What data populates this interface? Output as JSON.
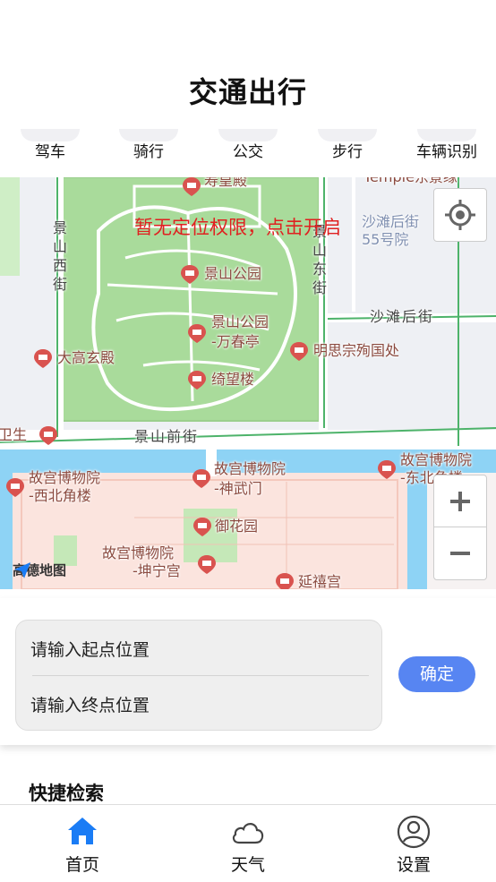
{
  "header": {
    "title": "交通出行"
  },
  "mode_tabs": [
    {
      "label": "驾车"
    },
    {
      "label": "骑行"
    },
    {
      "label": "公交"
    },
    {
      "label": "步行"
    },
    {
      "label": "车辆识别"
    }
  ],
  "map": {
    "permission_alert": "暂无定位权限，点击开启",
    "roads": {
      "jingshan_west": "景山西街",
      "jingshan_east": "景山东街",
      "jingshan_front": "景山前街",
      "shatan_back": "沙滩后街",
      "partial_left": "卫生"
    },
    "pois": {
      "shouhuangdian": "寿皇殿",
      "temple": "Temple东景缘",
      "shatan_55": "沙滩后街\n55号院",
      "jingshan_park": "景山公园",
      "wanchun_line1": "景山公园",
      "wanchun_line2": "-万春亭",
      "mingsizong": "明思宗殉国处",
      "dagaoxuan": "大高玄殿",
      "qiwanglou": "绮望楼",
      "gugong_xibei_1": "故宫博物院",
      "gugong_xibei_2": "-西北角楼",
      "gugong_shenwu_1": "故宫博物院",
      "gugong_shenwu_2": "-神武门",
      "gugong_dongbei_1": "故宫博物院",
      "gugong_dongbei_2": "-东北角楼",
      "yuhuayuan": "御花园",
      "gugong_kunning_1": "故宫博物院",
      "gugong_kunning_2": "-坤宁宫",
      "yanxigong": "延禧宫"
    },
    "logo_text": "高德地图",
    "zoom_in": "+",
    "zoom_out": "−"
  },
  "route": {
    "start_placeholder": "请输入起点位置",
    "end_placeholder": "请输入终点位置",
    "confirm_label": "确定"
  },
  "quick_search": {
    "title": "快捷检索"
  },
  "bottom_nav": [
    {
      "label": "首页",
      "icon": "home-icon",
      "active": true
    },
    {
      "label": "天气",
      "icon": "cloud-icon",
      "active": false
    },
    {
      "label": "设置",
      "icon": "user-icon",
      "active": false
    }
  ],
  "colors": {
    "accent": "#1a7cf5",
    "confirm_bg": "#5785f2",
    "alert": "#e02020",
    "park_green": "#a8db9a",
    "water": "#8ed3f5",
    "palace": "#fbe4de"
  }
}
